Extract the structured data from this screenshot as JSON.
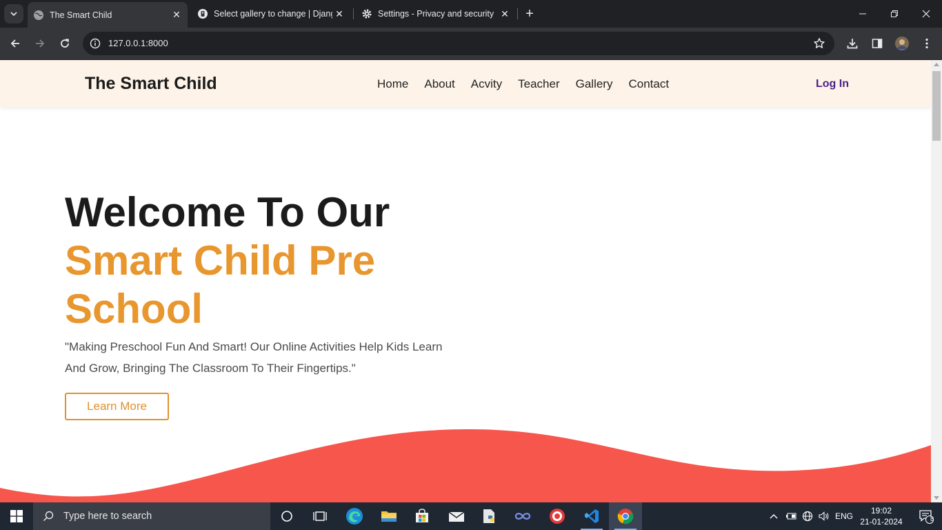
{
  "browser": {
    "tabs": [
      {
        "title": "The Smart Child",
        "active": true
      },
      {
        "title": "Select gallery to change | Djang",
        "active": false
      },
      {
        "title": "Settings - Privacy and security",
        "active": false
      }
    ],
    "url": "127.0.0.1:8000"
  },
  "site": {
    "brand": "The Smart Child",
    "nav": [
      "Home",
      "About",
      "Acvity",
      "Teacher",
      "Gallery",
      "Contact"
    ],
    "login": "Log In",
    "hero": {
      "line1": "Welcome To Our",
      "line2": "Smart Child Pre School",
      "paragraph": "\"Making Preschool Fun And Smart! Our Online Activities Help Kids Learn And Grow, Bringing The Classroom To Their Fingertips.\"",
      "button": "Learn More"
    },
    "colors": {
      "accent": "#e8962e",
      "wave": "#f6564c",
      "navbar": "#fdf3e8",
      "login": "#4a1f86"
    }
  },
  "taskbar": {
    "search_placeholder": "Type here to search",
    "language": "ENG",
    "time": "19:02",
    "date": "21-01-2024",
    "notifications": "8"
  }
}
